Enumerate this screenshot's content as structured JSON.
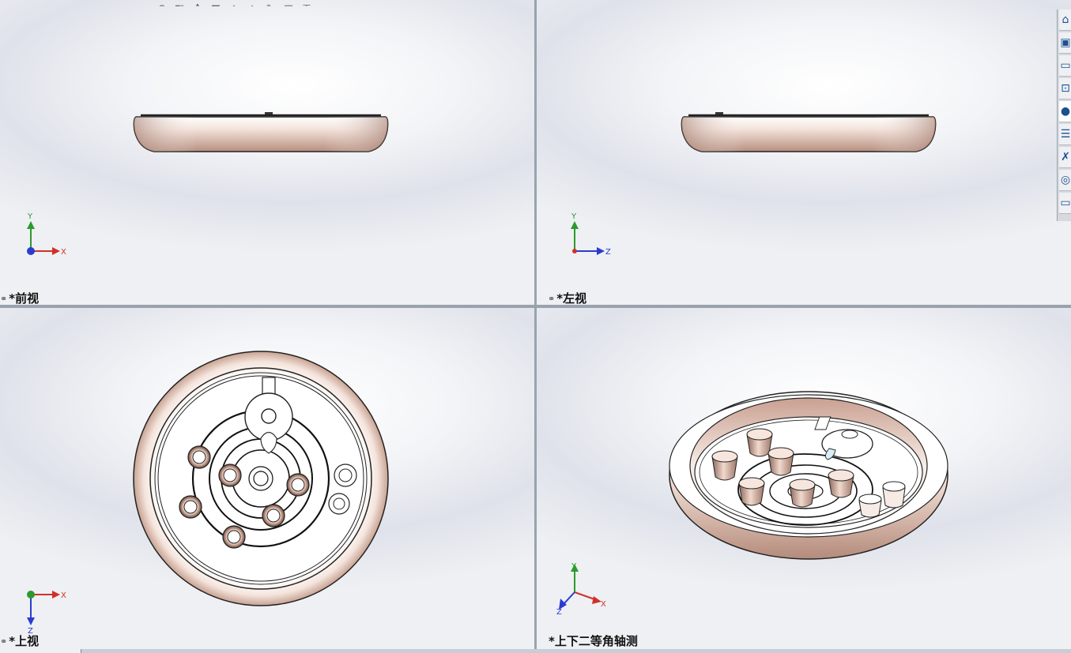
{
  "viewports": {
    "front": {
      "label": "*前视",
      "axes": [
        "Y",
        "X"
      ]
    },
    "left": {
      "label": "*左视",
      "axes": [
        "Y",
        "Z"
      ]
    },
    "top": {
      "label": "*上视",
      "axes": [
        "X",
        "Z"
      ]
    },
    "iso": {
      "label": "*上下二等角轴测",
      "axes": [
        "Y",
        "X",
        "Z"
      ]
    }
  },
  "link_icon": "link-chain-icon",
  "toolbar_icons": [
    "zoom-fit-icon",
    "zoom-area-icon",
    "previous-view-icon",
    "section-view-icon",
    "dynamic-annotation-icon",
    "view-orientation-icon",
    "display-style-icon",
    "hide-show-icon",
    "edit-appearance-icon",
    "apply-scene-icon",
    "view-settings-icon"
  ],
  "task_pane_icons": [
    "home-icon",
    "3d-parts-icon",
    "file-explorer-icon",
    "view-palette-icon",
    "appearances-icon",
    "custom-properties-icon",
    "design-library-icon",
    "solidworks-resources-icon",
    "forum-icon"
  ],
  "colors": {
    "x_axis": "#d0302a",
    "y_axis": "#2c9a2c",
    "z_axis": "#2a3bd0",
    "part_mid": "#e3c1b3",
    "part_light": "#ffffff"
  }
}
